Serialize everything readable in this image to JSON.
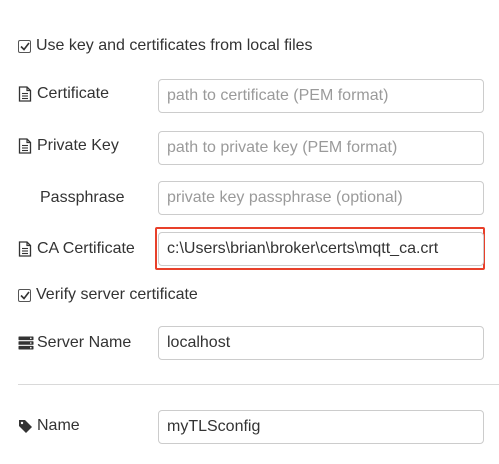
{
  "tls": {
    "use_local_files_label": "Use key and certificates from local files",
    "certificate": {
      "label": "Certificate",
      "placeholder": "path to certificate (PEM format)",
      "value": ""
    },
    "private_key": {
      "label": "Private Key",
      "placeholder": "path to private key (PEM format)",
      "value": ""
    },
    "passphrase": {
      "label": "Passphrase",
      "placeholder": "private key passphrase (optional)",
      "value": ""
    },
    "ca_certificate": {
      "label": "CA Certificate",
      "value": "c:\\Users\\brian\\broker\\certs\\mqtt_ca.crt"
    },
    "verify_server_label": "Verify server certificate",
    "server_name": {
      "label": "Server Name",
      "value": "localhost"
    },
    "name": {
      "label": "Name",
      "value": "myTLSconfig"
    }
  },
  "icons": {
    "certificate": "file-icon",
    "private_key": "file-icon",
    "ca_certificate": "file-icon",
    "server_name": "server-icon",
    "name": "tag-icon",
    "checkbox": "check-icon"
  },
  "colors": {
    "highlight": "#e8402a",
    "field_border": "#cccccc",
    "placeholder": "#9a9a9a",
    "text": "#333333"
  }
}
